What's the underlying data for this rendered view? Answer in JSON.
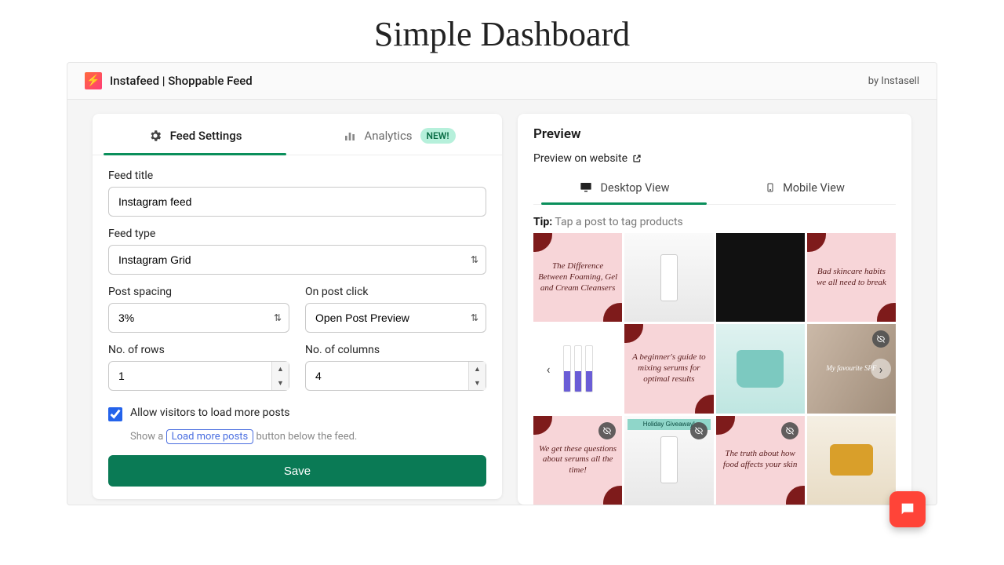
{
  "page_title": "Simple Dashboard",
  "header": {
    "app_name": "Instafeed | Shoppable Feed",
    "byline": "by Instasell",
    "logo_glyph": "⚡"
  },
  "tabs": {
    "settings": "Feed Settings",
    "analytics": "Analytics",
    "new_badge": "NEW!"
  },
  "form": {
    "feed_title_label": "Feed title",
    "feed_title_value": "Instagram feed",
    "feed_type_label": "Feed type",
    "feed_type_value": "Instagram Grid",
    "post_spacing_label": "Post spacing",
    "post_spacing_value": "3%",
    "on_click_label": "On post click",
    "on_click_value": "Open Post Preview",
    "rows_label": "No. of rows",
    "rows_value": "1",
    "cols_label": "No. of columns",
    "cols_value": "4",
    "checkbox_label": "Allow visitors to load more posts",
    "helper_prefix": "Show a ",
    "helper_chip": "Load more posts",
    "helper_suffix": " button below the feed.",
    "save_label": "Save"
  },
  "preview": {
    "title": "Preview",
    "link": "Preview on website",
    "desktop": "Desktop View",
    "mobile": "Mobile View",
    "tip_label": "Tip:",
    "tip_text": "Tap a post to tag products",
    "tiles": [
      {
        "type": "pink",
        "text": "The Difference Between Foaming, Gel and Cream Cleansers",
        "hidden": false
      },
      {
        "type": "product",
        "text": "",
        "hidden": false
      },
      {
        "type": "collage",
        "text": "",
        "hidden": false
      },
      {
        "type": "pink",
        "text": "Bad skincare habits we all need to break",
        "hidden": false
      },
      {
        "type": "tubes",
        "text": "",
        "hidden": false
      },
      {
        "type": "pink",
        "text": "A beginner's guide to mixing serums for optimal results",
        "hidden": false
      },
      {
        "type": "jar",
        "text": "",
        "hidden": false
      },
      {
        "type": "photo",
        "text": "My favourite SPF",
        "hidden": true
      },
      {
        "type": "pink",
        "text": "We get these questions about serums all the time!",
        "hidden": true
      },
      {
        "type": "product",
        "text": "",
        "hidden": true,
        "giveaway": "Holiday Giveaway!"
      },
      {
        "type": "pink",
        "text": "The truth about how food affects your skin",
        "hidden": true
      },
      {
        "type": "gold",
        "text": "",
        "hidden": false
      }
    ]
  }
}
